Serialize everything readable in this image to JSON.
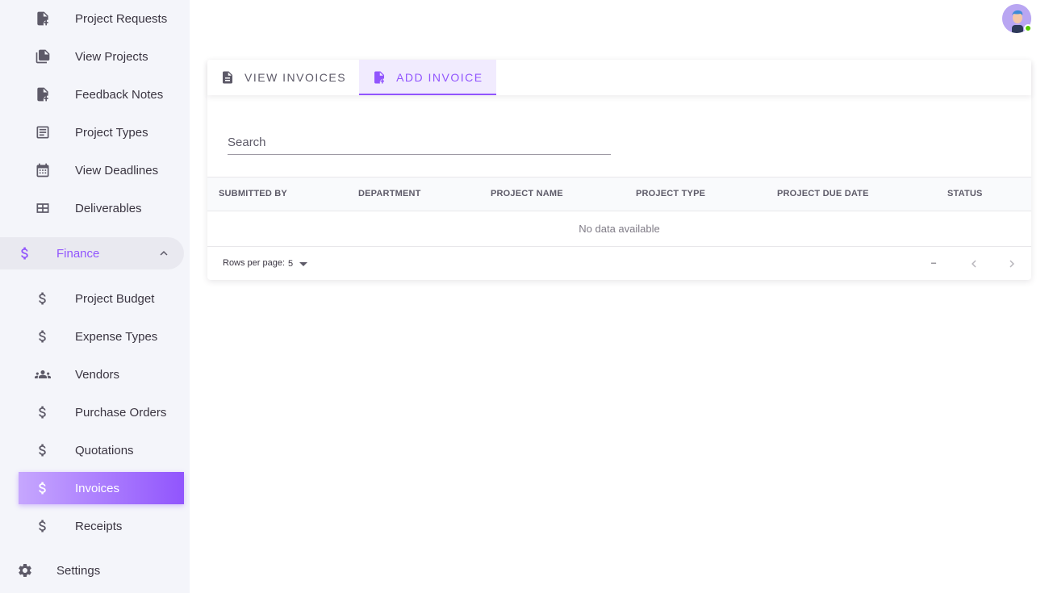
{
  "sidebar": {
    "items_top": [
      {
        "label": "Project Requests",
        "icon": "file-plus-icon"
      },
      {
        "label": "View Projects",
        "icon": "file-multiple-icon"
      },
      {
        "label": "Feedback Notes",
        "icon": "file-plus-icon"
      },
      {
        "label": "Project Types",
        "icon": "form-list-icon"
      },
      {
        "label": "View Deadlines",
        "icon": "calendar-icon"
      },
      {
        "label": "Deliverables",
        "icon": "table-icon"
      }
    ],
    "group": {
      "label": "Finance",
      "icon": "dollar-icon",
      "expanded": true
    },
    "items_finance": [
      {
        "label": "Project Budget",
        "icon": "dollar-icon"
      },
      {
        "label": "Expense Types",
        "icon": "dollar-icon"
      },
      {
        "label": "Vendors",
        "icon": "people-icon"
      },
      {
        "label": "Purchase Orders",
        "icon": "dollar-icon"
      },
      {
        "label": "Quotations",
        "icon": "dollar-icon"
      },
      {
        "label": "Invoices",
        "icon": "dollar-icon",
        "active": true
      },
      {
        "label": "Receipts",
        "icon": "dollar-icon"
      }
    ],
    "settings": {
      "label": "Settings",
      "icon": "gear-icon"
    }
  },
  "tabs": [
    {
      "label": "View Invoices",
      "icon": "document-icon",
      "active": false
    },
    {
      "label": "Add Invoice",
      "icon": "document-plus-icon",
      "active": true
    }
  ],
  "search": {
    "placeholder": "Search",
    "value": ""
  },
  "table": {
    "columns": [
      "Submitted By",
      "Department",
      "Project Name",
      "Project Type",
      "Project Due Date",
      "Status"
    ],
    "rows": [],
    "empty_text": "No data available"
  },
  "pagination": {
    "rows_per_page_label": "Rows per page:",
    "rows_per_page": "5",
    "range_text": "–"
  },
  "colors": {
    "accent": "#9155fd",
    "sidebar_bg": "#f4f5fa",
    "online": "#56ca00"
  }
}
